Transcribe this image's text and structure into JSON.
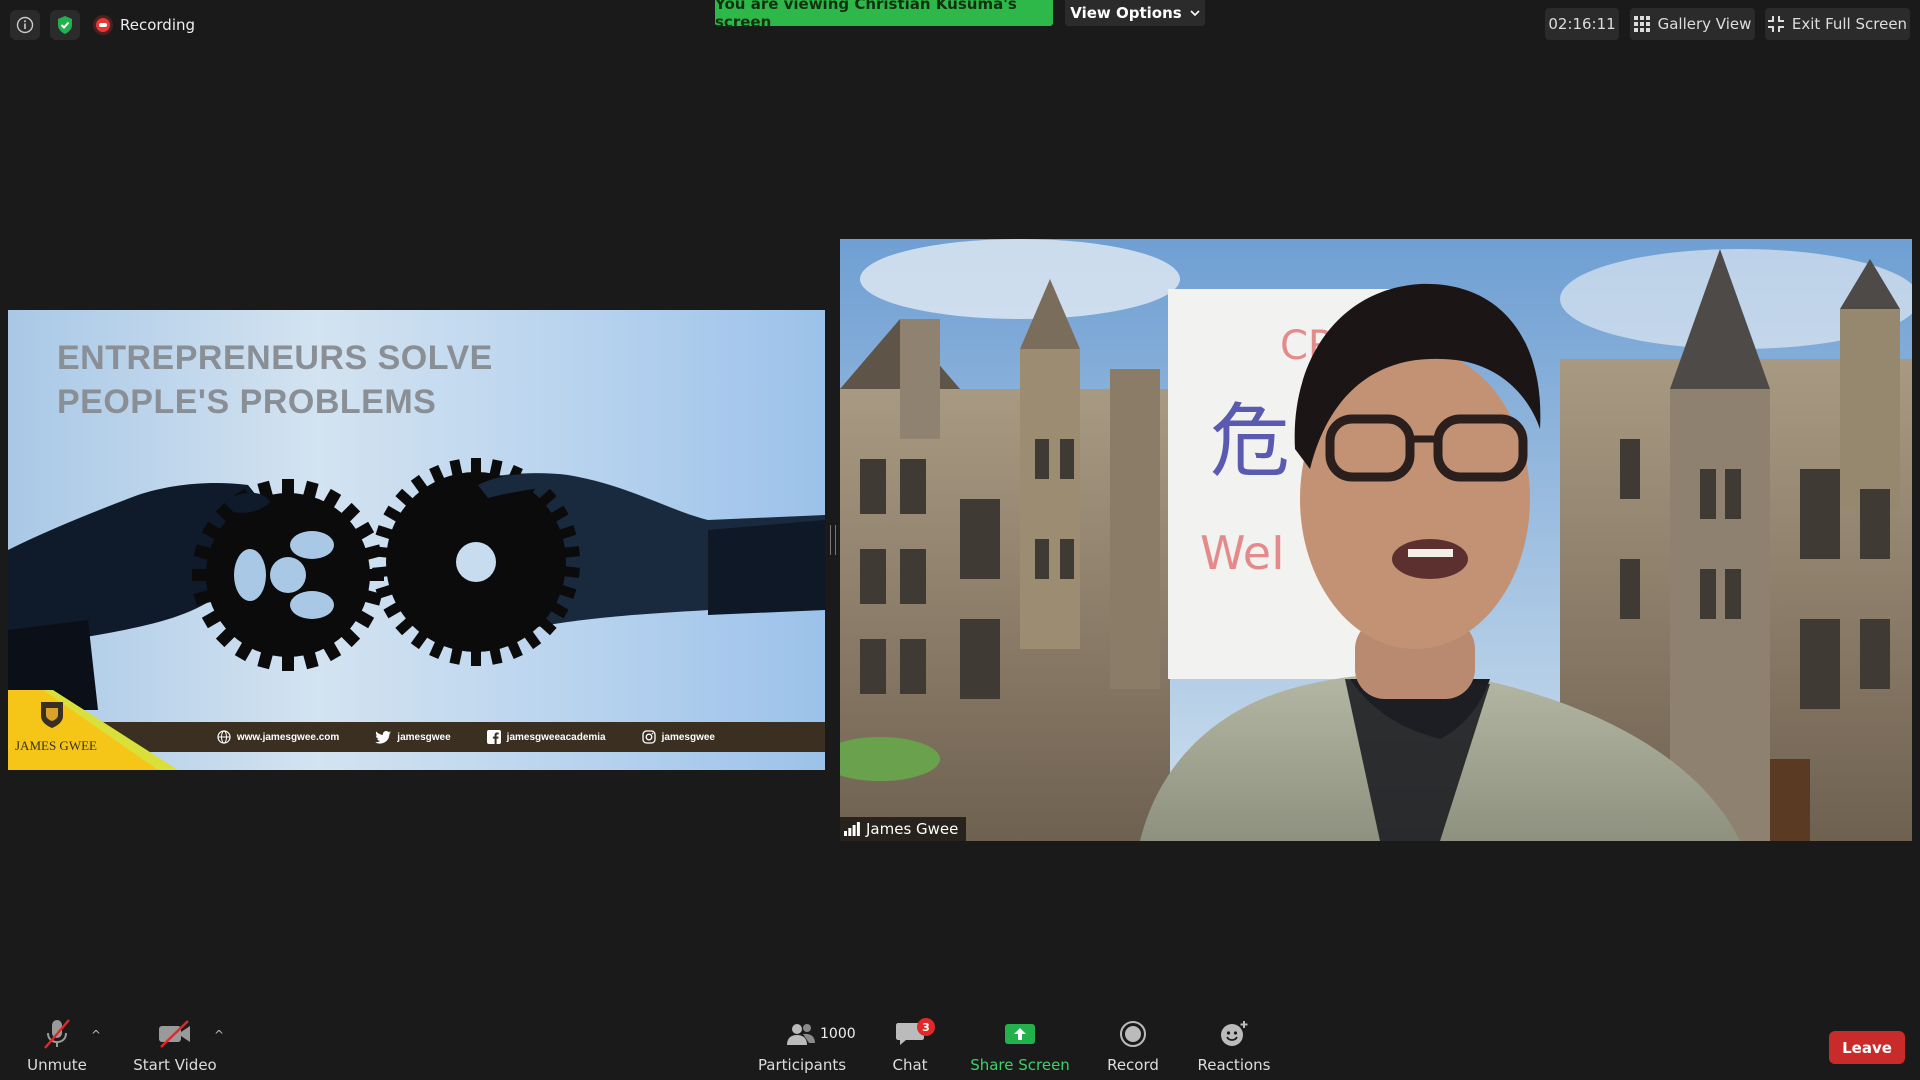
{
  "top_bar": {
    "recording_label": "Recording",
    "viewing_banner": "You are viewing Christian Kusuma's screen",
    "view_options_label": "View Options",
    "timer": "02:16:11",
    "gallery_view_label": "Gallery View",
    "exit_full_screen_label": "Exit Full Screen"
  },
  "shared_slide": {
    "title_line1": "ENTREPRENEURS SOLVE",
    "title_line2": "PEOPLE'S PROBLEMS",
    "brand": "JAMES GWEE",
    "footer": {
      "website": "www.jamesgwee.com",
      "twitter": "jamesgwee",
      "facebook": "jamesgweeacademia",
      "instagram": "jamesgwee"
    }
  },
  "video": {
    "participant_name": "James Gwee"
  },
  "toolbar": {
    "unmute_label": "Unmute",
    "start_video_label": "Start Video",
    "participants_label": "Participants",
    "participants_count": "1000",
    "chat_label": "Chat",
    "chat_badge": "3",
    "share_screen_label": "Share Screen",
    "record_label": "Record",
    "reactions_label": "Reactions",
    "leave_label": "Leave"
  },
  "colors": {
    "background": "#1a1a1a",
    "banner_green": "#2fb84a",
    "leave_red": "#c92b2b",
    "share_green": "#23b14d"
  }
}
